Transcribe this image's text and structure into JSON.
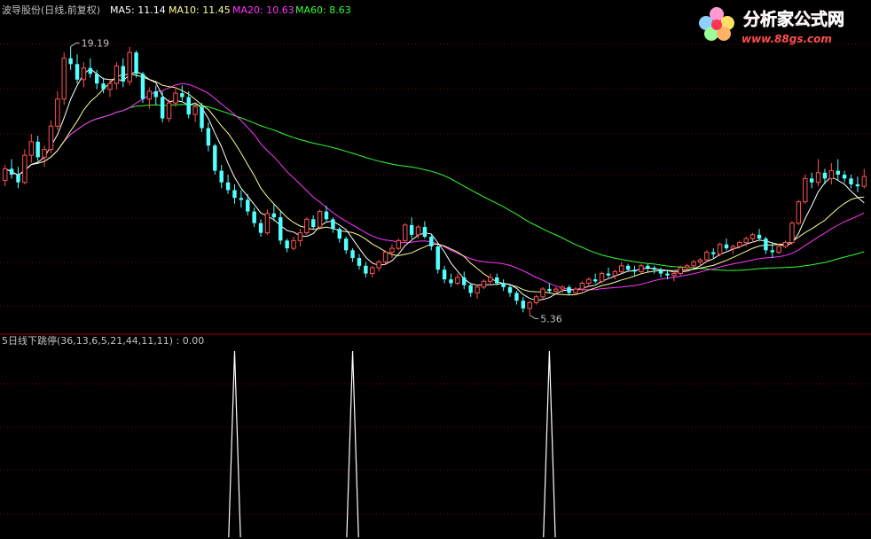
{
  "header": {
    "stock_name": "波导股份(日线,前复权)",
    "ma5_label": "MA5: 11.14",
    "ma10_label": "MA10: 11.45",
    "ma20_label": "MA20: 10.63",
    "ma60_label": "MA60: 8.63"
  },
  "annotations": {
    "high": "19.19",
    "low": "5.36"
  },
  "watermark": {
    "brand_text": "分析家公式网",
    "url_text": "www.88gs.com"
  },
  "indicator": {
    "label": "5日线下跳停(36,13,6,5,21,44,11,11) : 0.00"
  },
  "colors": {
    "up": "#ff5252",
    "down": "#54ffff",
    "ma5": "#ffffff",
    "ma10": "#ffff99",
    "ma20": "#ff33ff",
    "ma60": "#33ff33",
    "grid": "#7a0000",
    "text": "#c0c0c0"
  },
  "chart_data": [
    {
      "type": "candlestick",
      "price_range": [
        4.6,
        20.6
      ],
      "candles": [
        [
          12.3,
          13.1,
          12.0,
          12.9
        ],
        [
          12.9,
          13.4,
          12.4,
          12.6
        ],
        [
          12.6,
          13.0,
          11.9,
          12.2
        ],
        [
          12.2,
          13.9,
          12.1,
          13.6
        ],
        [
          13.6,
          14.7,
          13.2,
          14.3
        ],
        [
          14.3,
          14.6,
          13.3,
          13.5
        ],
        [
          13.5,
          14.1,
          13.0,
          13.9
        ],
        [
          13.9,
          15.4,
          13.7,
          15.1
        ],
        [
          15.1,
          16.9,
          14.9,
          16.5
        ],
        [
          16.5,
          18.9,
          16.2,
          18.6
        ],
        [
          18.6,
          19.2,
          18.0,
          18.3
        ],
        [
          18.3,
          18.8,
          17.3,
          17.5
        ],
        [
          17.5,
          18.4,
          17.1,
          18.1
        ],
        [
          18.1,
          18.6,
          17.6,
          17.8
        ],
        [
          17.8,
          18.0,
          17.0,
          17.3
        ],
        [
          17.3,
          17.6,
          16.8,
          17.0
        ],
        [
          17.0,
          17.5,
          16.6,
          17.3
        ],
        [
          17.3,
          18.4,
          17.0,
          18.2
        ],
        [
          18.2,
          18.6,
          17.1,
          17.4
        ],
        [
          17.4,
          19.19,
          17.2,
          18.9
        ],
        [
          18.9,
          19.0,
          17.6,
          17.8
        ],
        [
          17.8,
          17.9,
          16.3,
          16.5
        ],
        [
          16.5,
          17.1,
          16.0,
          16.9
        ],
        [
          16.9,
          17.2,
          16.2,
          16.6
        ],
        [
          16.6,
          16.9,
          15.3,
          15.5
        ],
        [
          15.5,
          16.5,
          15.3,
          16.3
        ],
        [
          16.3,
          17.1,
          16.1,
          16.8
        ],
        [
          16.8,
          17.2,
          16.4,
          16.6
        ],
        [
          16.6,
          16.9,
          15.5,
          15.7
        ],
        [
          15.7,
          16.3,
          15.3,
          16.1
        ],
        [
          16.1,
          16.3,
          14.8,
          15.0
        ],
        [
          15.0,
          15.3,
          13.8,
          14.1
        ],
        [
          14.1,
          14.2,
          12.6,
          12.8
        ],
        [
          12.8,
          13.1,
          11.9,
          12.2
        ],
        [
          12.2,
          12.6,
          11.6,
          11.8
        ],
        [
          11.8,
          12.1,
          11.1,
          11.4
        ],
        [
          11.4,
          11.8,
          10.9,
          11.3
        ],
        [
          11.3,
          11.6,
          10.5,
          10.7
        ],
        [
          10.7,
          10.9,
          9.9,
          10.1
        ],
        [
          10.1,
          10.3,
          9.4,
          9.6
        ],
        [
          9.6,
          10.8,
          9.5,
          10.6
        ],
        [
          10.6,
          11.1,
          10.2,
          10.4
        ],
        [
          10.4,
          10.7,
          9.0,
          9.2
        ],
        [
          9.2,
          9.3,
          8.6,
          8.8
        ],
        [
          8.8,
          9.4,
          8.7,
          9.2
        ],
        [
          9.2,
          9.8,
          8.9,
          9.6
        ],
        [
          9.6,
          10.4,
          9.5,
          10.3
        ],
        [
          10.3,
          10.5,
          9.8,
          9.9
        ],
        [
          9.9,
          10.8,
          9.9,
          10.7
        ],
        [
          10.7,
          11.0,
          10.2,
          10.3
        ],
        [
          10.3,
          10.4,
          9.6,
          9.8
        ],
        [
          9.8,
          9.9,
          9.1,
          9.3
        ],
        [
          9.3,
          9.4,
          8.5,
          8.7
        ],
        [
          8.7,
          8.8,
          8.1,
          8.3
        ],
        [
          8.3,
          8.5,
          7.7,
          7.9
        ],
        [
          7.9,
          8.1,
          7.3,
          7.5
        ],
        [
          7.5,
          7.9,
          7.3,
          7.8
        ],
        [
          7.8,
          8.2,
          7.6,
          8.1
        ],
        [
          8.1,
          8.7,
          8.0,
          8.6
        ],
        [
          8.6,
          9.0,
          8.3,
          8.8
        ],
        [
          8.8,
          9.3,
          8.7,
          9.2
        ],
        [
          9.2,
          10.1,
          9.1,
          10.0
        ],
        [
          10.0,
          10.4,
          9.3,
          9.5
        ],
        [
          9.5,
          10.0,
          9.3,
          9.9
        ],
        [
          9.9,
          10.2,
          9.3,
          9.4
        ],
        [
          9.4,
          9.5,
          8.7,
          8.9
        ],
        [
          8.9,
          9.0,
          7.5,
          7.7
        ],
        [
          7.7,
          7.9,
          7.0,
          7.2
        ],
        [
          7.2,
          7.5,
          6.8,
          7.0
        ],
        [
          7.0,
          7.5,
          6.9,
          7.3
        ],
        [
          7.3,
          7.6,
          6.7,
          6.9
        ],
        [
          6.9,
          7.0,
          6.3,
          6.5
        ],
        [
          6.5,
          6.9,
          6.2,
          6.8
        ],
        [
          6.8,
          7.2,
          6.7,
          7.1
        ],
        [
          7.1,
          7.5,
          6.9,
          7.3
        ],
        [
          7.3,
          7.5,
          6.9,
          7.0
        ],
        [
          7.0,
          7.2,
          6.6,
          6.8
        ],
        [
          6.8,
          6.9,
          6.3,
          6.5
        ],
        [
          6.5,
          6.6,
          5.9,
          6.1
        ],
        [
          6.1,
          6.3,
          5.5,
          5.7
        ],
        [
          5.7,
          6.1,
          5.36,
          6.0
        ],
        [
          6.0,
          6.4,
          5.9,
          6.3
        ],
        [
          6.3,
          6.8,
          6.2,
          6.7
        ],
        [
          6.7,
          7.0,
          6.5,
          6.6
        ],
        [
          6.6,
          6.8,
          6.4,
          6.7
        ],
        [
          6.7,
          6.9,
          6.5,
          6.8
        ],
        [
          6.8,
          6.9,
          6.4,
          6.5
        ],
        [
          6.5,
          6.8,
          6.4,
          6.7
        ],
        [
          6.7,
          7.1,
          6.6,
          7.0
        ],
        [
          7.0,
          7.3,
          6.8,
          7.2
        ],
        [
          7.2,
          7.5,
          7.0,
          7.1
        ],
        [
          7.1,
          7.6,
          7.0,
          7.5
        ],
        [
          7.5,
          7.8,
          7.3,
          7.4
        ],
        [
          7.4,
          7.7,
          7.2,
          7.6
        ],
        [
          7.6,
          8.1,
          7.5,
          7.9
        ],
        [
          7.9,
          8.0,
          7.6,
          7.7
        ],
        [
          7.7,
          7.9,
          7.4,
          7.6
        ],
        [
          7.6,
          8.0,
          7.5,
          7.9
        ],
        [
          7.9,
          8.0,
          7.6,
          7.8
        ],
        [
          7.8,
          7.9,
          7.5,
          7.7
        ],
        [
          7.7,
          7.8,
          7.3,
          7.5
        ],
        [
          7.5,
          7.7,
          7.2,
          7.4
        ],
        [
          7.4,
          7.6,
          7.1,
          7.5
        ],
        [
          7.5,
          7.9,
          7.4,
          7.8
        ],
        [
          7.8,
          8.0,
          7.6,
          7.9
        ],
        [
          7.9,
          8.2,
          7.8,
          8.1
        ],
        [
          8.1,
          8.3,
          7.9,
          8.2
        ],
        [
          8.2,
          8.7,
          8.1,
          8.6
        ],
        [
          8.6,
          8.8,
          8.3,
          8.5
        ],
        [
          8.5,
          9.1,
          8.4,
          9.0
        ],
        [
          9.0,
          9.3,
          8.7,
          8.8
        ],
        [
          8.8,
          9.0,
          8.5,
          8.9
        ],
        [
          8.9,
          9.2,
          8.8,
          9.1
        ],
        [
          9.1,
          9.4,
          8.9,
          9.3
        ],
        [
          9.3,
          9.6,
          9.1,
          9.5
        ],
        [
          9.5,
          9.8,
          9.2,
          9.3
        ],
        [
          9.3,
          9.4,
          8.5,
          8.7
        ],
        [
          8.7,
          9.1,
          8.3,
          8.6
        ],
        [
          8.6,
          9.0,
          8.5,
          8.9
        ],
        [
          8.9,
          9.2,
          8.8,
          9.1
        ],
        [
          9.1,
          10.2,
          9.0,
          10.1
        ],
        [
          10.1,
          11.3,
          10.0,
          11.2
        ],
        [
          11.2,
          12.6,
          11.1,
          12.4
        ],
        [
          12.4,
          12.7,
          11.9,
          12.2
        ],
        [
          12.2,
          13.4,
          12.0,
          12.7
        ],
        [
          12.7,
          12.9,
          12.1,
          12.4
        ],
        [
          12.4,
          13.2,
          12.1,
          12.8
        ],
        [
          12.8,
          13.4,
          12.3,
          12.6
        ],
        [
          12.6,
          12.8,
          12.2,
          12.4
        ],
        [
          12.4,
          12.6,
          11.9,
          12.1
        ],
        [
          12.1,
          12.5,
          11.7,
          12.0
        ],
        [
          12.0,
          12.9,
          11.9,
          12.5
        ]
      ],
      "ma5_last": 11.14,
      "ma10_last": 11.45,
      "ma20_last": 10.63,
      "ma60_last": 8.63
    },
    {
      "type": "spikes",
      "title": "5日线下跳停(36,13,6,5,21,44,11,11)",
      "current_value": 0.0,
      "spike_indices": [
        35,
        53,
        83
      ],
      "value_range": [
        0,
        1
      ]
    }
  ]
}
